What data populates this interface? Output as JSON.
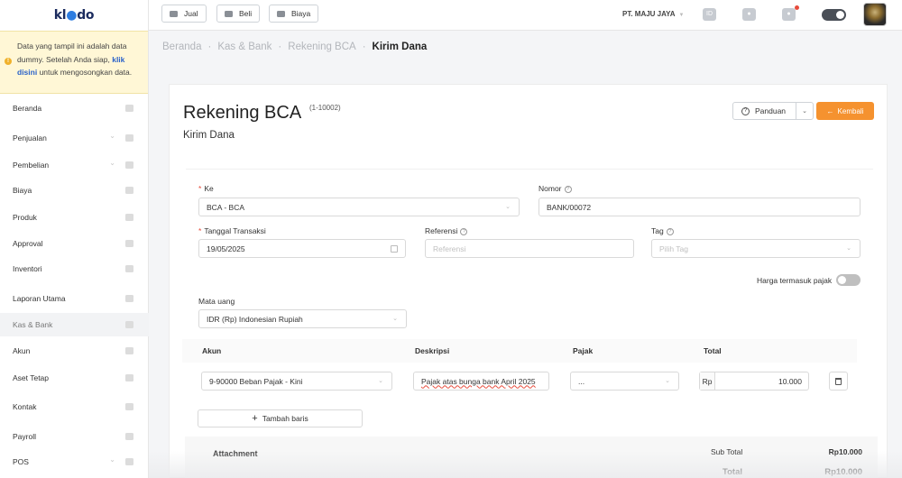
{
  "sidebar": {
    "logo": {
      "part1": "kl",
      "part2": "do"
    },
    "dummy_notice": {
      "text_before": "Data yang tampil ini adalah data dummy. Setelah Anda siap, ",
      "link": "klik disini",
      "text_after": " untuk mengosongkan data."
    },
    "items": [
      {
        "label": "Beranda",
        "icon": "home-icon"
      },
      {
        "label": "Penjualan",
        "icon": "basket-icon"
      },
      {
        "label": "Pembelian",
        "icon": "bag-icon"
      },
      {
        "label": "Biaya",
        "icon": "wallet-icon"
      },
      {
        "label": "Produk",
        "icon": "box-icon"
      },
      {
        "label": "Approval",
        "icon": "check-icon"
      },
      {
        "label": "Inventori",
        "icon": "warehouse-icon"
      },
      {
        "label": "Laporan Utama",
        "icon": "chart-icon"
      },
      {
        "label": "Kas & Bank",
        "icon": "dollar-icon"
      },
      {
        "label": "Akun",
        "icon": "account-icon"
      },
      {
        "label": "Aset Tetap",
        "icon": "building-icon"
      },
      {
        "label": "Kontak",
        "icon": "contact-icon"
      },
      {
        "label": "Payroll",
        "icon": "payroll-icon"
      },
      {
        "label": "POS",
        "icon": "pos-icon"
      }
    ]
  },
  "topbar": {
    "buttons": {
      "jual": "Jual",
      "beli": "Beli",
      "biaya": "Biaya"
    },
    "company": "PT. MAJU JAYA"
  },
  "breadcrumb": {
    "home": "Beranda",
    "kas": "Kas & Bank",
    "rekening": "Rekening BCA",
    "current": "Kirim Dana"
  },
  "header": {
    "title": "Rekening BCA",
    "code": "(1-10002)",
    "subtitle": "Kirim Dana",
    "panduan": "Panduan",
    "kembali": "Kembali"
  },
  "form": {
    "ke": {
      "label": "Ke",
      "value": "BCA - BCA"
    },
    "nomor": {
      "label": "Nomor",
      "value": "BANK/00072"
    },
    "tanggal": {
      "label": "Tanggal Transaksi",
      "value": "19/05/2025"
    },
    "referensi": {
      "label": "Referensi",
      "placeholder": "Referensi"
    },
    "tag": {
      "label": "Tag",
      "placeholder": "Pilih Tag"
    },
    "harga_pajak": "Harga termasuk pajak",
    "mata_uang": {
      "label": "Mata uang",
      "value": "IDR (Rp) Indonesian Rupiah"
    }
  },
  "table": {
    "headers": {
      "akun": "Akun",
      "deskripsi": "Deskripsi",
      "pajak": "Pajak",
      "total": "Total"
    },
    "rows": [
      {
        "akun": "9-90000 Beban Pajak - Kini",
        "deskripsi": "Pajak atas bunga bank April 2025",
        "pajak": "...",
        "currency": "Rp",
        "total": "10.000"
      }
    ],
    "add_row": "Tambah baris"
  },
  "summary": {
    "attachment": "Attachment",
    "subtotal_label": "Sub Total",
    "subtotal_value": "Rp10.000",
    "total_label": "Total",
    "total_value": "Rp10.000"
  }
}
